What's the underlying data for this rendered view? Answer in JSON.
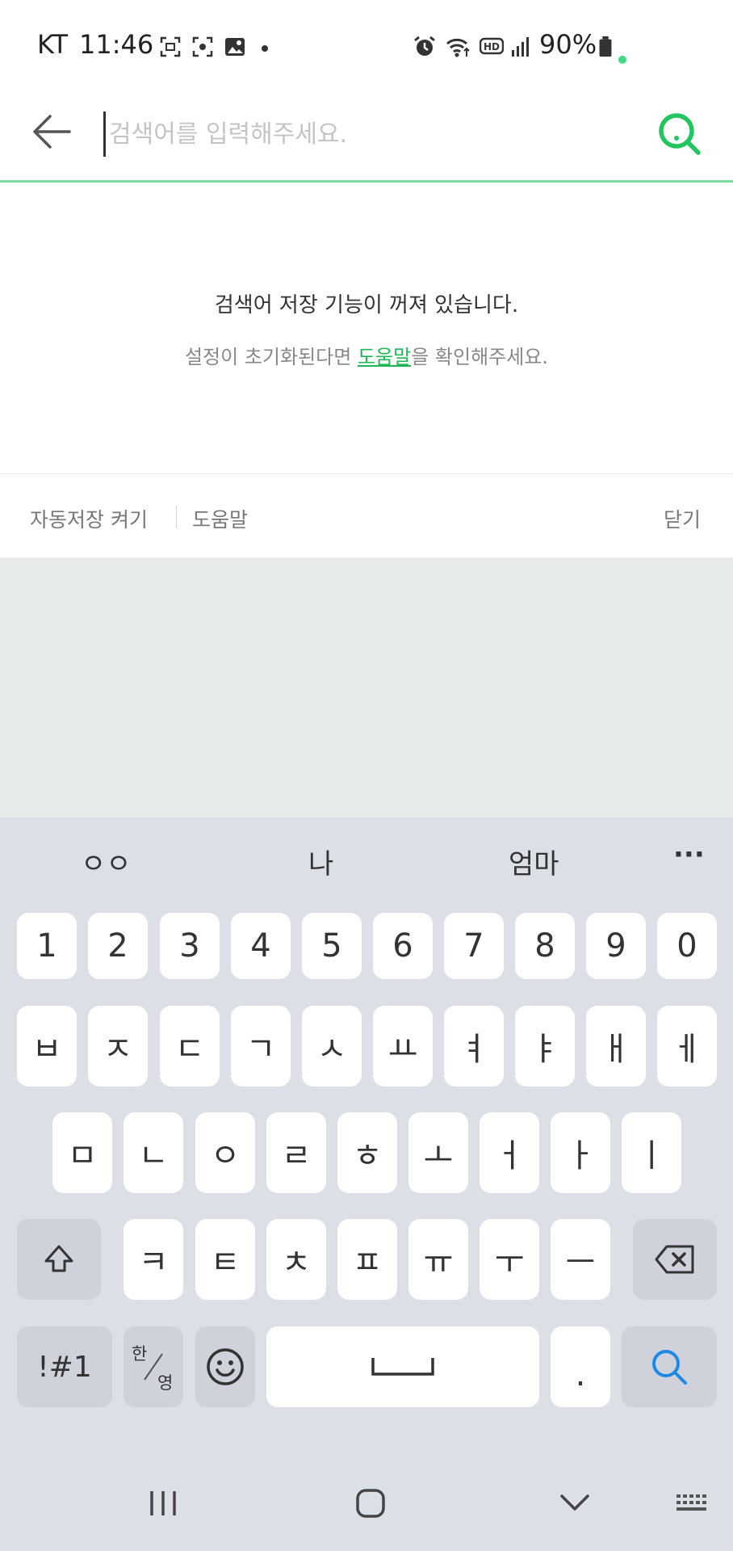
{
  "status_bar": {
    "carrier": "KT",
    "time": "11:46",
    "battery": "90%"
  },
  "search": {
    "placeholder": "검색어를 입력해주세요."
  },
  "notice": {
    "title": "검색어 저장 기능이 꺼져 있습니다.",
    "sub_prefix": "설정이 초기화된다면 ",
    "sub_link": "도움말",
    "sub_suffix": "을 확인해주세요."
  },
  "footer": {
    "autosave_label": "자동저장 켜기",
    "help_label": "도움말",
    "close_label": "닫기"
  },
  "keyboard": {
    "suggestions": [
      "ㅇㅇ",
      "나",
      "엄마"
    ],
    "more_label": "···",
    "numbers": [
      "1",
      "2",
      "3",
      "4",
      "5",
      "6",
      "7",
      "8",
      "9",
      "0"
    ],
    "row1": [
      "ㅂ",
      "ㅈ",
      "ㄷ",
      "ㄱ",
      "ㅅ",
      "ㅛ",
      "ㅕ",
      "ㅑ",
      "ㅐ",
      "ㅔ"
    ],
    "row2": [
      "ㅁ",
      "ㄴ",
      "ㅇ",
      "ㄹ",
      "ㅎ",
      "ㅗ",
      "ㅓ",
      "ㅏ",
      "ㅣ"
    ],
    "row3": [
      "ㅋ",
      "ㅌ",
      "ㅊ",
      "ㅍ",
      "ㅠ",
      "ㅜ",
      "ㅡ"
    ],
    "symbols_label": "!#1",
    "lang_top": "한",
    "lang_bottom": "영",
    "period_label": "."
  },
  "colors": {
    "accent": "#1db954",
    "search_icon": "#22c55e",
    "keyboard_search": "#1e88e5"
  }
}
